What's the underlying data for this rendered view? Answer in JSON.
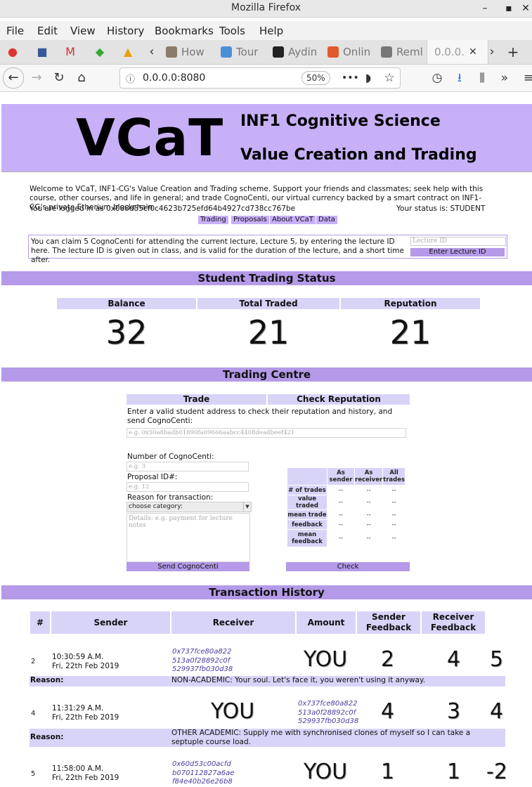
{
  "window": {
    "title": "Mozilla Firefox",
    "minimize": "–",
    "maximize": "▪",
    "close": "✕"
  },
  "menu": [
    "File",
    "Edit",
    "View",
    "History",
    "Bookmarks",
    "Tools",
    "Help"
  ],
  "tabs": [
    {
      "label": "How",
      "color": "#8a7c6a"
    },
    {
      "label": "Tour",
      "color": "#4a90d9"
    },
    {
      "label": "Aydin",
      "color": "#222222"
    },
    {
      "label": "Onlin",
      "color": "#e05a2b"
    },
    {
      "label": "Reml",
      "color": "#777777"
    },
    {
      "label": "0.0.0.",
      "active": true
    }
  ],
  "navbar": {
    "url": "0.0.0.0:8080",
    "zoom": "50%",
    "more": "•••"
  },
  "header": {
    "brand": "VCaT",
    "subtitle1": "INF1 Cognitive Science",
    "subtitle2": "Value Creation and Trading"
  },
  "intro": {
    "welcome": "Welcome to VCaT, INF1-CG's Value Creation and Trading scheme. Support your friends and classmates; seek help with this course, other courses, and life in general; and trade CognoCenti, our virtual currency backed by a smart contract on INF1-CG's private Etherium blockchain.",
    "logged_in": "You are logged in as 0x088d55cf0c4623b725efd64b4927cd738cc767be",
    "status": "Your status is: STUDENT"
  },
  "nav_links": [
    "Trading",
    "Proposals",
    "About VCaT",
    "Data"
  ],
  "claim": {
    "text": "You can claim 5 CognoCenti for attending the current lecture, Lecture 5, by entering the lecture ID here. The lecture ID is given out in class, and is valid for the duration of the lecture, and a short time after.",
    "placeholder": "Lecture ID",
    "button": "Enter Lecture ID"
  },
  "student_status": {
    "title": "Student Trading Status",
    "headers": [
      "Balance",
      "Total Traded",
      "Reputation"
    ],
    "values": [
      "32",
      "21",
      "21"
    ]
  },
  "trading": {
    "title": "Trading Centre",
    "tab_trade": "Trade",
    "tab_reputation": "Check Reputation",
    "instructions": "Enter a valid student address to check their reputation and history, and send CognoCenti:",
    "address_placeholder": "e.g. 0x50a8badb01890fa09666aabcc4408deadbeef421",
    "amount_label": "Number of CognoCenti:",
    "amount_placeholder": "e.g. 3",
    "proposal_label": "Proposal ID#:",
    "proposal_placeholder": "e.g. 12",
    "reason_label": "Reason for transaction:",
    "category": "choose category:",
    "details_placeholder": "Details: e.g. payment for lecture notes",
    "send_button": "Send CognoCenti",
    "check_button": "Check",
    "rep_cols": [
      "As sender",
      "As receiver",
      "All trades"
    ],
    "rep_rows": [
      {
        "label": "# of trades",
        "vals": [
          "--",
          "--",
          "--"
        ]
      },
      {
        "label": "value traded",
        "vals": [
          "--",
          "--",
          "--"
        ]
      },
      {
        "label": "mean trade",
        "vals": [
          "--",
          "--",
          "--"
        ]
      },
      {
        "label": "feedback",
        "vals": [
          "--",
          "--",
          "--"
        ]
      },
      {
        "label": "mean feedback",
        "vals": [
          "--",
          "--",
          "--"
        ]
      }
    ]
  },
  "history": {
    "title": "Transaction History",
    "headers": [
      "#",
      "Sender",
      "Receiver",
      "Amount",
      "Sender Feedback",
      "Receiver Feedback"
    ],
    "reason_label": "Reason:",
    "rows": [
      {
        "num": "2",
        "time": "10:30:59 A.M.",
        "date": "Fri, 22th Feb 2019",
        "sender_addr": [
          "0x737fce80a822",
          "513a0f28892c0f",
          "529937fb030d38"
        ],
        "receiver": "YOU",
        "amount": "2",
        "sender_fb": "4",
        "receiver_fb": "5",
        "reason": "NON-ACADEMIC: Your soul. Let's face it, you weren't using it anyway."
      },
      {
        "num": "4",
        "time": "11:31:29 A.M.",
        "date": "Fri, 22th Feb 2019",
        "sender": "YOU",
        "receiver_addr": [
          "0x737fce80a822",
          "513a0f28892c0f",
          "529937fb030d38"
        ],
        "amount": "4",
        "sender_fb": "3",
        "receiver_fb": "4",
        "reason": "OTHER ACADEMIC: Supply me with synchronised clones of myself so I can take a septuple course load."
      },
      {
        "num": "5",
        "time": "11:58:00 A.M.",
        "date": "Fri, 22th Feb 2019",
        "sender_addr": [
          "0x60d53c00acfd",
          "b070112827a6ae",
          "f84e40b26e26b8"
        ],
        "receiver": "YOU",
        "amount": "1",
        "sender_fb": "1",
        "receiver_fb": "-2"
      }
    ]
  }
}
